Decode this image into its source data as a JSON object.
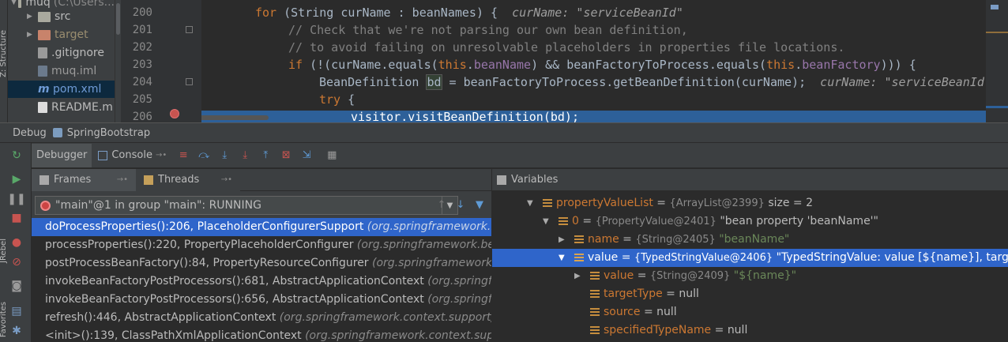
{
  "project_tree": {
    "side_label": "Z: Structure",
    "items": [
      {
        "label": "muq",
        "extra": "(C:\\Users...",
        "kind": "module",
        "arrow": "▼"
      },
      {
        "label": "src",
        "kind": "folder",
        "arrow": "▶"
      },
      {
        "label": "target",
        "kind": "folder-excluded",
        "arrow": "▶"
      },
      {
        "label": ".gitignore",
        "kind": "file",
        "arrow": ""
      },
      {
        "label": "muq.iml",
        "kind": "file",
        "arrow": ""
      },
      {
        "label": "pom.xml",
        "kind": "file",
        "arrow": ""
      },
      {
        "label": "README.m",
        "kind": "file",
        "arrow": ""
      }
    ]
  },
  "editor": {
    "line_numbers": [
      "200",
      "201",
      "202",
      "203",
      "204",
      "205",
      "206"
    ],
    "lines": {
      "l200_kw": "for",
      "l200_code": " (String curName : beanNames) {  ",
      "l200_inline": "curName: \"serviceBeanId\"",
      "l201": "// Check that we're not parsing our own bean definition,",
      "l202": "// to avoid failing on unresolvable placeholders in properties file locations.",
      "l203_kw": "if",
      "l203_a": " (!(curName.equals(",
      "l203_this1": "this",
      "l203_b": ".",
      "l203_f1": "beanName",
      "l203_c": ") && beanFactoryToProcess.equals(",
      "l203_this2": "this",
      "l203_d": ".",
      "l203_f2": "beanFactory",
      "l203_e": "))) {",
      "l204_a": "BeanDefinition ",
      "l204_hl": "bd",
      "l204_b": " = beanFactoryToProcess.getBeanDefinition(curName);  ",
      "l204_inline": "curName: \"serviceBeanId\"",
      "l205_kw": "try",
      "l205_b": " {",
      "l206": "visitor.visitBeanDefinition(bd);"
    }
  },
  "debug": {
    "title": "Debug",
    "config_name": "SpringBootstrap",
    "tabs": [
      {
        "label": "Debugger",
        "active": true
      },
      {
        "label": "Console",
        "active": false
      }
    ],
    "toolbar_icons": [
      "show-execution-point-icon",
      "step-over-icon",
      "step-into-icon",
      "force-step-into-icon",
      "step-out-icon",
      "drop-frame-icon",
      "run-to-cursor-icon",
      "evaluate-expression-icon"
    ],
    "frames_tab": "Frames",
    "threads_tab": "Threads",
    "thread_selector": "\"main\"@1 in group \"main\": RUNNING",
    "frames": [
      {
        "method": "doProcessProperties():206, PlaceholderConfigurerSupport",
        "pkg": "(org.springframework.beans.factory.config)",
        "selected": true
      },
      {
        "method": "processProperties():220, PropertyPlaceholderConfigurer",
        "pkg": "(org.springframework.beans.factory.config)",
        "selected": false
      },
      {
        "method": "postProcessBeanFactory():84, PropertyResourceConfigurer",
        "pkg": "(org.springframework.beans.factory.config)",
        "selected": false
      },
      {
        "method": "invokeBeanFactoryPostProcessors():681, AbstractApplicationContext",
        "pkg": "(org.springframework.context.support)",
        "selected": false
      },
      {
        "method": "invokeBeanFactoryPostProcessors():656, AbstractApplicationContext",
        "pkg": "(org.springframework.context.support)",
        "selected": false
      },
      {
        "method": "refresh():446, AbstractApplicationContext",
        "pkg": "(org.springframework.context.support)",
        "selected": false
      },
      {
        "method": "<init>():139, ClassPathXmlApplicationContext",
        "pkg": "(org.springframework.context.support)",
        "selected": false
      }
    ],
    "variables_title": "Variables",
    "variables": [
      {
        "name": "propertyValueList",
        "type": "{ArrayList@2399}",
        "value": " size = 2",
        "expanded": true,
        "indent": 0,
        "selected": false,
        "green": false
      },
      {
        "name": "0",
        "type": "{PropertyValue@2401}",
        "value": " \"bean property 'beanName'\"",
        "expanded": true,
        "indent": 1,
        "selected": false,
        "green": false
      },
      {
        "name": "name",
        "type": "{String@2405}",
        "value": " \"beanName\"",
        "expanded": false,
        "indent": 2,
        "selected": false,
        "green": true
      },
      {
        "name": "value",
        "type": "{TypedStringValue@2406}",
        "value": " \"TypedStringValue: value [${name}], target ...",
        "expanded": true,
        "indent": 2,
        "selected": true,
        "green": false
      },
      {
        "name": "value",
        "type": "{String@2409}",
        "value": " \"${name}\"",
        "expanded": false,
        "indent": 3,
        "selected": false,
        "green": true
      },
      {
        "name": "targetType",
        "type": "",
        "value": "null",
        "expanded": null,
        "indent": 3,
        "selected": false,
        "green": false
      },
      {
        "name": "source",
        "type": "",
        "value": "null",
        "expanded": null,
        "indent": 3,
        "selected": false,
        "green": false
      },
      {
        "name": "specifiedTypeName",
        "type": "",
        "value": "null",
        "expanded": null,
        "indent": 3,
        "selected": false,
        "green": false
      }
    ],
    "side_labels": {
      "jrebel": "JRebel",
      "favorites": "Favorites"
    }
  },
  "colors": {
    "selection": "#2f65ca",
    "exec_line": "#2d6099",
    "keyword": "#cc7832",
    "breakpoint": "#c75450"
  }
}
